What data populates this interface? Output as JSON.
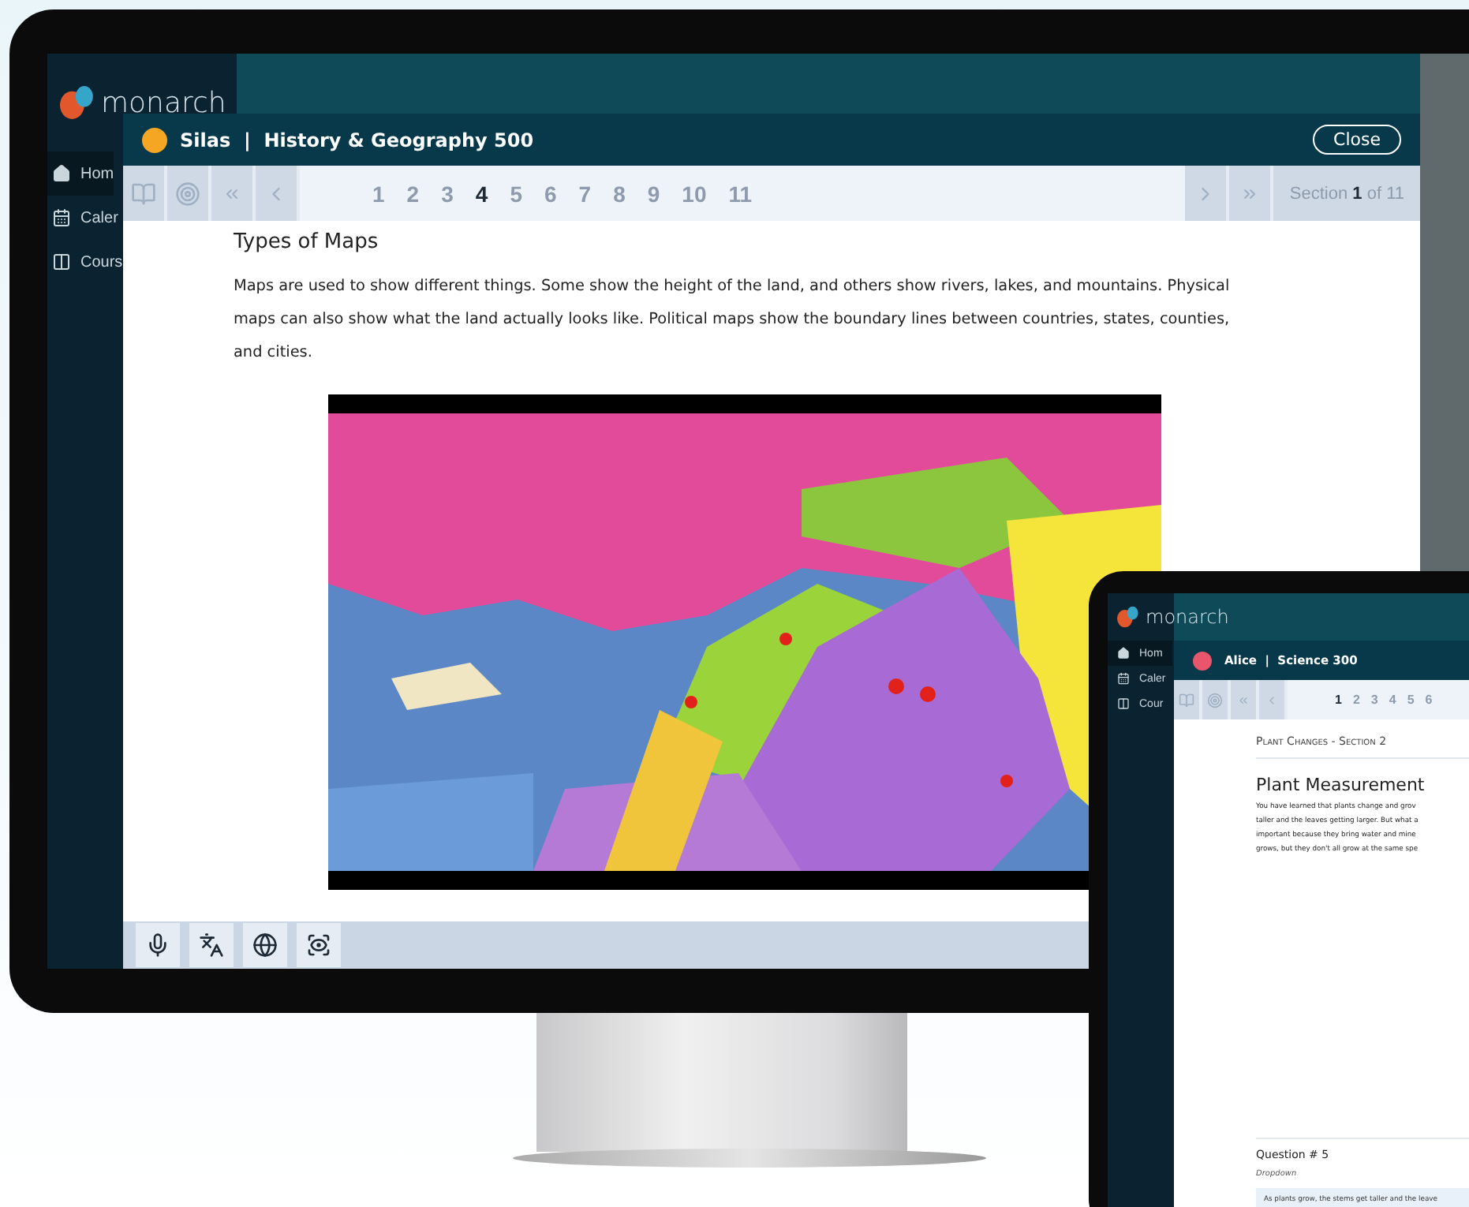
{
  "monitor": {
    "brand": "monarch",
    "sidebar": {
      "items": [
        {
          "label": "Hom",
          "selected": true
        },
        {
          "label": "Caler",
          "selected": false
        },
        {
          "label": "Cours",
          "selected": false
        }
      ]
    },
    "modal": {
      "title": "Silas  |  History & Geography 500",
      "close": "Close",
      "pages": [
        {
          "label": "1",
          "selected": false
        },
        {
          "label": "2",
          "selected": false
        },
        {
          "label": "3",
          "selected": false
        },
        {
          "label": "4",
          "selected": true
        },
        {
          "label": "5",
          "selected": false
        },
        {
          "label": "6",
          "selected": false
        },
        {
          "label": "7",
          "selected": false
        },
        {
          "label": "8",
          "selected": false
        },
        {
          "label": "9",
          "selected": false
        },
        {
          "label": "10",
          "selected": false
        },
        {
          "label": "11",
          "selected": false
        }
      ],
      "section": "Section **1** of 11",
      "heading": "Types of Maps",
      "paragraph": "Maps are used to show different things. Some show the height of the land, and others show rivers, lakes, and mountains. Physical maps can also show what the land actually looks like. Political maps show the boundary lines between countries, states, counties, and cities."
    }
  },
  "tablet": {
    "brand": "monarch",
    "sidebar": {
      "items": [
        {
          "label": "Hom",
          "selected": true
        },
        {
          "label": "Caler",
          "selected": false
        },
        {
          "label": "Cour",
          "selected": false
        }
      ]
    },
    "modal": {
      "title": "Alice  |  Science 300",
      "pages": [
        {
          "label": "1",
          "selected": true
        },
        {
          "label": "2",
          "selected": false
        },
        {
          "label": "3",
          "selected": false
        },
        {
          "label": "4",
          "selected": false
        },
        {
          "label": "5",
          "selected": false
        },
        {
          "label": "6",
          "selected": false
        }
      ],
      "breadcrumb": "Plant Changes - Section 2",
      "heading": "Plant Measurement",
      "lines": [
        "You have learned that plants change and grov",
        "taller and the leaves getting larger. But what a",
        "important because they bring water and mine",
        "grows, but they don't all grow at the same spe"
      ],
      "question": "Question # 5",
      "question_type": "Dropdown",
      "answer": "As plants grow, the stems get taller and the leave"
    }
  }
}
